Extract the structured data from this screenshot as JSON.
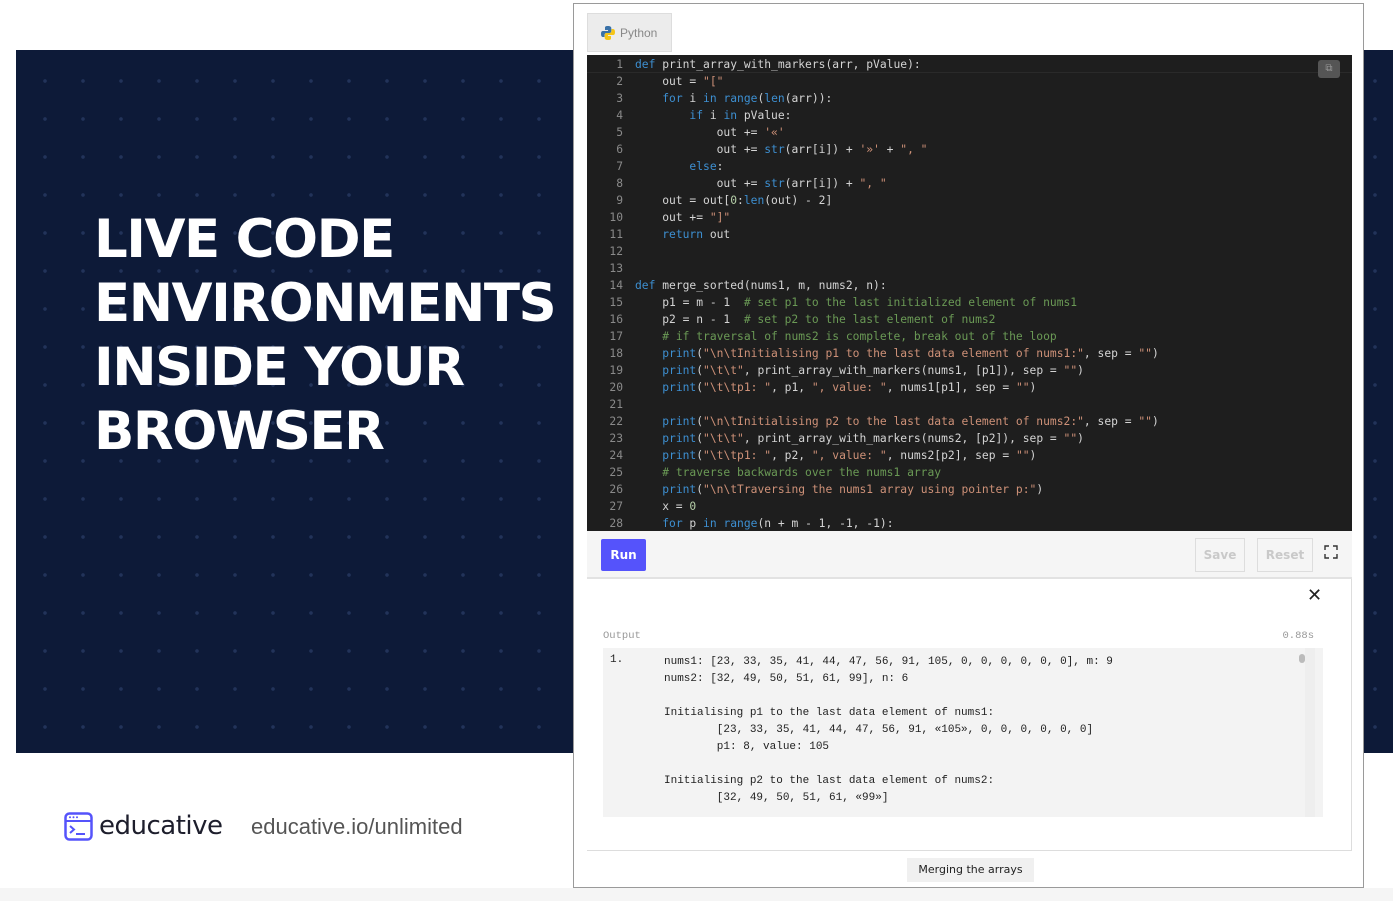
{
  "hero": {
    "headline": [
      "LIVE CODE",
      "ENVIRONMENTS",
      "INSIDE YOUR",
      "BROWSER"
    ],
    "background": "#0d1a38"
  },
  "brand": {
    "name": "educative",
    "url": "educative.io/unlimited",
    "accent": "#5553fb"
  },
  "widget": {
    "tab": {
      "label": "Python",
      "icon": "python-logo-icon"
    },
    "copy_icon": "copy-icon",
    "code": [
      [
        [
          "kw",
          "def "
        ],
        [
          "",
          "print_array_with_markers(arr, pValue):"
        ]
      ],
      [
        [
          "",
          "    out = "
        ],
        [
          "str",
          "\"[\""
        ]
      ],
      [
        [
          "",
          "    "
        ],
        [
          "kw",
          "for"
        ],
        [
          "",
          " i "
        ],
        [
          "kw",
          "in"
        ],
        [
          "",
          " "
        ],
        [
          "fn",
          "range"
        ],
        [
          "",
          "("
        ],
        [
          "fn",
          "len"
        ],
        [
          "",
          "(arr)):"
        ]
      ],
      [
        [
          "",
          "        "
        ],
        [
          "kw",
          "if"
        ],
        [
          "",
          " i "
        ],
        [
          "kw",
          "in"
        ],
        [
          "",
          " pValue:"
        ]
      ],
      [
        [
          "",
          "            out += "
        ],
        [
          "str",
          "'«'"
        ]
      ],
      [
        [
          "",
          "            out += "
        ],
        [
          "fn",
          "str"
        ],
        [
          "",
          "(arr[i]) + "
        ],
        [
          "str",
          "'»'"
        ],
        [
          "",
          " + "
        ],
        [
          "str",
          "\", \""
        ]
      ],
      [
        [
          "",
          "        "
        ],
        [
          "kw",
          "else"
        ],
        [
          "",
          ":"
        ]
      ],
      [
        [
          "",
          "            out += "
        ],
        [
          "fn",
          "str"
        ],
        [
          "",
          "(arr[i]) + "
        ],
        [
          "str",
          "\", \""
        ]
      ],
      [
        [
          "",
          "    out = out["
        ],
        [
          "num",
          "0"
        ],
        [
          "",
          ":"
        ],
        [
          "fn",
          "len"
        ],
        [
          "",
          "(out) - 2]"
        ]
      ],
      [
        [
          "",
          "    out += "
        ],
        [
          "str",
          "\"]\""
        ]
      ],
      [
        [
          "",
          "    "
        ],
        [
          "kw",
          "return"
        ],
        [
          "",
          " out"
        ]
      ],
      [],
      [],
      [
        [
          "kw",
          "def "
        ],
        [
          "",
          "merge_sorted(nums1, m, nums2, n):"
        ]
      ],
      [
        [
          "",
          "    p1 = m - 1  "
        ],
        [
          "cm",
          "# set p1 to the last initialized element of nums1"
        ]
      ],
      [
        [
          "",
          "    p2 = n - 1  "
        ],
        [
          "cm",
          "# set p2 to the last element of nums2"
        ]
      ],
      [
        [
          "",
          "    "
        ],
        [
          "cm",
          "# if traversal of nums2 is complete, break out of the loop"
        ]
      ],
      [
        [
          "",
          "    "
        ],
        [
          "fn",
          "print"
        ],
        [
          "",
          "("
        ],
        [
          "str",
          "\"\\n\\tInitialising p1 to the last data element of nums1:\""
        ],
        [
          "",
          ", sep = "
        ],
        [
          "str",
          "\"\""
        ],
        [
          "",
          ")"
        ]
      ],
      [
        [
          "",
          "    "
        ],
        [
          "fn",
          "print"
        ],
        [
          "",
          "("
        ],
        [
          "str",
          "\"\\t\\t\""
        ],
        [
          "",
          ", print_array_with_markers(nums1, [p1]), sep = "
        ],
        [
          "str",
          "\"\""
        ],
        [
          "",
          ")"
        ]
      ],
      [
        [
          "",
          "    "
        ],
        [
          "fn",
          "print"
        ],
        [
          "",
          "("
        ],
        [
          "str",
          "\"\\t\\tp1: \""
        ],
        [
          "",
          ", p1, "
        ],
        [
          "str",
          "\", value: \""
        ],
        [
          "",
          ", nums1[p1], sep = "
        ],
        [
          "str",
          "\"\""
        ],
        [
          "",
          ")"
        ]
      ],
      [],
      [
        [
          "",
          "    "
        ],
        [
          "fn",
          "print"
        ],
        [
          "",
          "("
        ],
        [
          "str",
          "\"\\n\\tInitialising p2 to the last data element of nums2:\""
        ],
        [
          "",
          ", sep = "
        ],
        [
          "str",
          "\"\""
        ],
        [
          "",
          ")"
        ]
      ],
      [
        [
          "",
          "    "
        ],
        [
          "fn",
          "print"
        ],
        [
          "",
          "("
        ],
        [
          "str",
          "\"\\t\\t\""
        ],
        [
          "",
          ", print_array_with_markers(nums2, [p2]), sep = "
        ],
        [
          "str",
          "\"\""
        ],
        [
          "",
          ")"
        ]
      ],
      [
        [
          "",
          "    "
        ],
        [
          "fn",
          "print"
        ],
        [
          "",
          "("
        ],
        [
          "str",
          "\"\\t\\tp1: \""
        ],
        [
          "",
          ", p2, "
        ],
        [
          "str",
          "\", value: \""
        ],
        [
          "",
          ", nums2[p2], sep = "
        ],
        [
          "str",
          "\"\""
        ],
        [
          "",
          ")"
        ]
      ],
      [
        [
          "",
          "    "
        ],
        [
          "cm",
          "# traverse backwards over the nums1 array"
        ]
      ],
      [
        [
          "",
          "    "
        ],
        [
          "fn",
          "print"
        ],
        [
          "",
          "("
        ],
        [
          "str",
          "\"\\n\\tTraversing the nums1 array using pointer p:\""
        ],
        [
          "",
          ")"
        ]
      ],
      [
        [
          "",
          "    x = "
        ],
        [
          "num",
          "0"
        ]
      ],
      [
        [
          "",
          "    "
        ],
        [
          "kw",
          "for"
        ],
        [
          "",
          " p "
        ],
        [
          "kw",
          "in"
        ],
        [
          "",
          " "
        ],
        [
          "fn",
          "range"
        ],
        [
          "",
          "(n + m - 1, -1, -1):"
        ]
      ]
    ],
    "toolbar": {
      "run": "Run",
      "save": "Save",
      "reset": "Reset",
      "fullscreen_icon": "fullscreen-icon"
    },
    "output": {
      "close_icon": "close-icon",
      "label": "Output",
      "time": "0.88s",
      "index": "1.",
      "lines": [
        "nums1: [23, 33, 35, 41, 44, 47, 56, 91, 105, 0, 0, 0, 0, 0, 0], m: 9",
        "nums2: [32, 49, 50, 51, 61, 99], n: 6",
        "",
        "Initialising p1 to the last data element of nums1:",
        "        [23, 33, 35, 41, 44, 47, 56, 91, «105», 0, 0, 0, 0, 0, 0]",
        "        p1: 8, value: 105",
        "",
        "Initialising p2 to the last data element of nums2:",
        "        [32, 49, 50, 51, 61, «99»]"
      ]
    },
    "caption": "Merging the arrays"
  }
}
